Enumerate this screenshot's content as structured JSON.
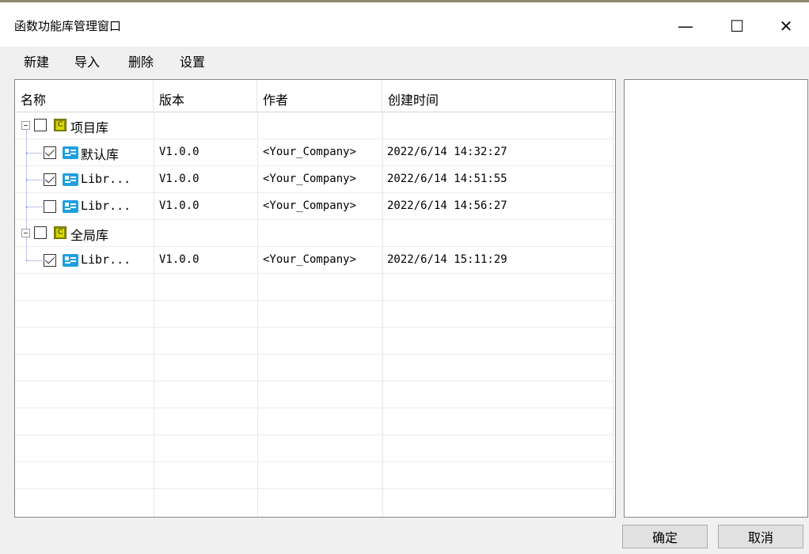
{
  "window": {
    "title": "函数功能库管理窗口",
    "minimize_glyph": "—",
    "maximize_glyph": "☐",
    "close_glyph": "✕"
  },
  "menu": [
    "新建",
    "导入",
    "删除",
    "设置"
  ],
  "table": {
    "columns": [
      "名称",
      "版本",
      "作者",
      "创建时间"
    ],
    "groups": [
      {
        "name": "项目库",
        "icon_letter": "C",
        "checked": false,
        "items": [
          {
            "name": "默认库",
            "version": "V1.0.0",
            "author": "<Your_Company>",
            "created": "2022/6/14 14:32:27",
            "checked": true
          },
          {
            "name": "Libr...",
            "version": "V1.0.0",
            "author": "<Your_Company>",
            "created": "2022/6/14 14:51:55",
            "checked": true
          },
          {
            "name": "Libr...",
            "version": "V1.0.0",
            "author": "<Your_Company>",
            "created": "2022/6/14 14:56:27",
            "checked": false
          }
        ]
      },
      {
        "name": "全局库",
        "icon_letter": "C",
        "checked": false,
        "items": [
          {
            "name": "Libr...",
            "version": "V1.0.0",
            "author": "<Your_Company>",
            "created": "2022/6/14 15:11:29",
            "checked": true
          }
        ]
      }
    ]
  },
  "buttons": {
    "ok": "确定",
    "cancel": "取消"
  },
  "colors": {
    "library_icon": "#1e9fe0",
    "group_icon": "#8b8b00",
    "tree_line": "#7a8cd6"
  }
}
